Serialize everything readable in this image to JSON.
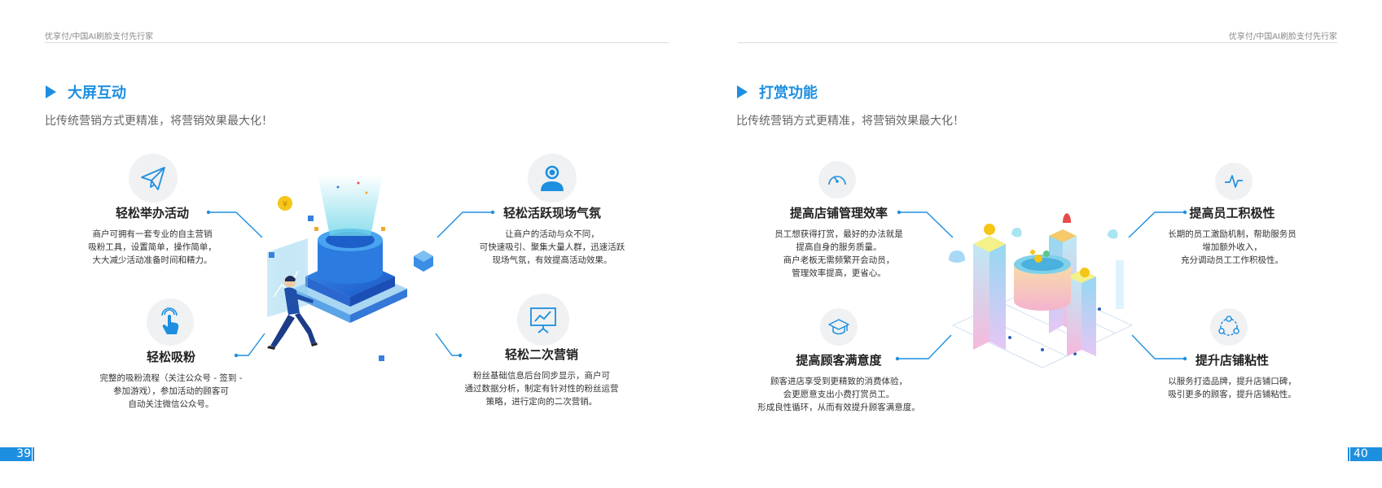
{
  "header": {
    "left": "优享付/中国AI刷脸支付先行家",
    "right": "优享付/中国AI刷脸支付先行家"
  },
  "left_page": {
    "title": "大屏互动",
    "subtitle": "比传统营销方式更精准，将营销效果最大化！",
    "features": [
      {
        "title": "轻松举办活动",
        "lines": [
          "商户可拥有一套专业的自主营销",
          "吸粉工具，设置简单，操作简单，",
          "大大减少活动准备时间和精力。"
        ]
      },
      {
        "title": "轻松活跃现场气氛",
        "lines": [
          "让商户的活动与众不同，",
          "可快速吸引、聚集大量人群，迅速活跃",
          "现场气氛，有效提高活动效果。"
        ]
      },
      {
        "title": "轻松吸粉",
        "lines": [
          "完整的吸粉流程（关注公众号 - 签到 -",
          "参加游戏），参加活动的顾客可",
          "自动关注微信公众号。"
        ]
      },
      {
        "title": "轻松二次营销",
        "lines": [
          "粉丝基础信息后台同步显示，商户可",
          "通过数据分析，制定有针对性的粉丝运营",
          "策略，进行定向的二次营销。"
        ]
      }
    ],
    "page_number": "39"
  },
  "right_page": {
    "title": "打赏功能",
    "subtitle": "比传统营销方式更精准，将营销效果最大化！",
    "features": [
      {
        "title": "提高店铺管理效率",
        "lines": [
          "员工想获得打赏，最好的办法就是",
          "提高自身的服务质量。",
          "商户老板无需频繁开会动员，",
          "管理效率提高，更省心。"
        ]
      },
      {
        "title": "提高员工积极性",
        "lines": [
          "长期的员工激励机制，帮助服务员",
          "增加额外收入，",
          "充分调动员工工作积极性。"
        ]
      },
      {
        "title": "提高顾客满意度",
        "lines": [
          "顾客进店享受到更精致的消费体验，",
          "会更愿意支出小费打赏员工。",
          "形成良性循环，从而有效提升顾客满意度。"
        ]
      },
      {
        "title": "提升店铺粘性",
        "lines": [
          "以服务打造品牌，提升店铺口碑，",
          "吸引更多的顾客，提升店铺粘性。"
        ]
      }
    ],
    "page_number": "40"
  },
  "icons": {
    "left": [
      "paper-plane-icon",
      "user-icon",
      "touch-hand-icon",
      "presentation-chart-icon"
    ],
    "right": [
      "speedometer-icon",
      "pulse-icon",
      "graduation-cap-icon",
      "connection-nodes-icon"
    ]
  },
  "colors": {
    "accent": "#1e8fe0",
    "icon_bg": "#f0f1f3"
  }
}
